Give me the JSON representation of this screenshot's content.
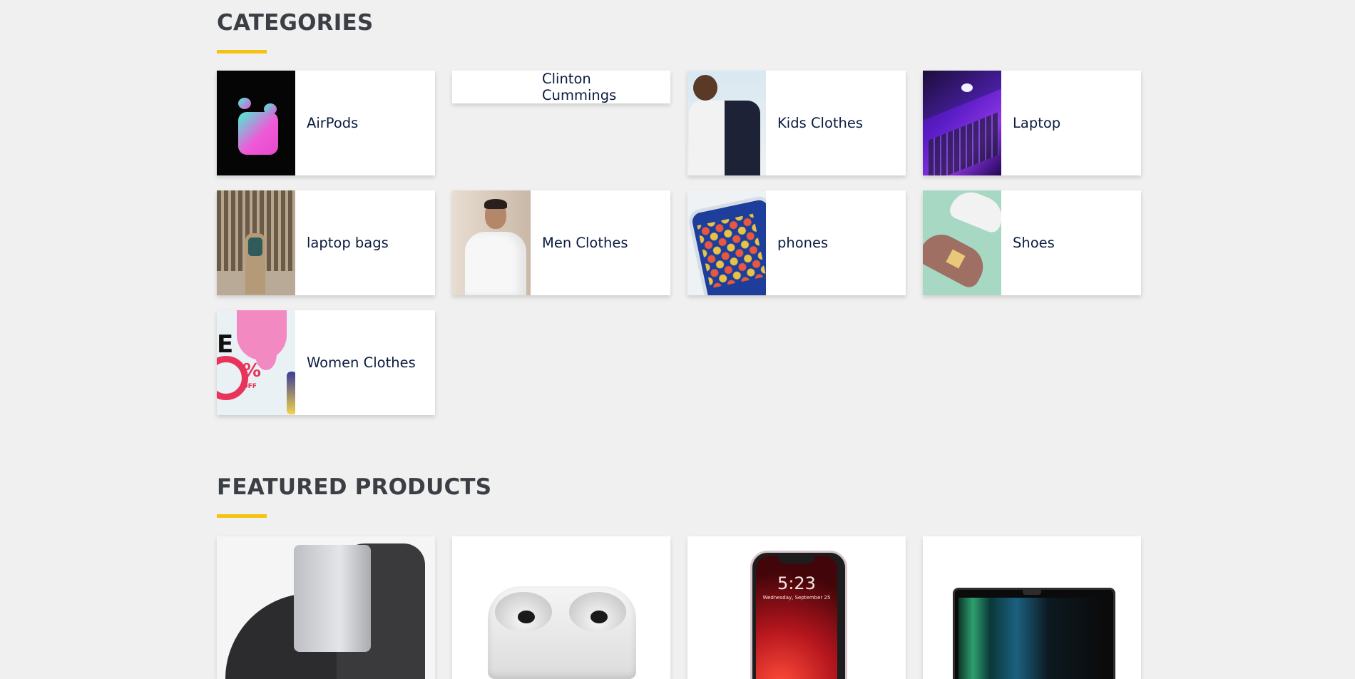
{
  "categories_section": {
    "title": "CATEGORIES",
    "items": [
      {
        "label": "AirPods",
        "image": "airpods-case"
      },
      {
        "label": "Clinton Cummings",
        "image": "none"
      },
      {
        "label": "Kids Clothes",
        "image": "child-in-polo"
      },
      {
        "label": "Laptop",
        "image": "purple-laptop"
      },
      {
        "label": "laptop bags",
        "image": "man-with-backpack"
      },
      {
        "label": "Men Clothes",
        "image": "man-in-white-shirt"
      },
      {
        "label": "phones",
        "image": "smartphone-apps"
      },
      {
        "label": "Shoes",
        "image": "sneakers"
      },
      {
        "label": "Women Clothes",
        "image": "sale-poster"
      }
    ]
  },
  "featured_section": {
    "title": "FEATURED PRODUCTS",
    "products": [
      {
        "image": "laptop-backpack"
      },
      {
        "image": "airpods-pro"
      },
      {
        "image": "iphone",
        "screen_time": "5:23",
        "screen_date": "Wednesday, September 25"
      },
      {
        "image": "macbook-pro"
      }
    ]
  },
  "colors": {
    "background": "#f0f0f0",
    "accent_underline": "#f5c211",
    "heading": "#3b3f45",
    "label": "#0b1b3f"
  }
}
